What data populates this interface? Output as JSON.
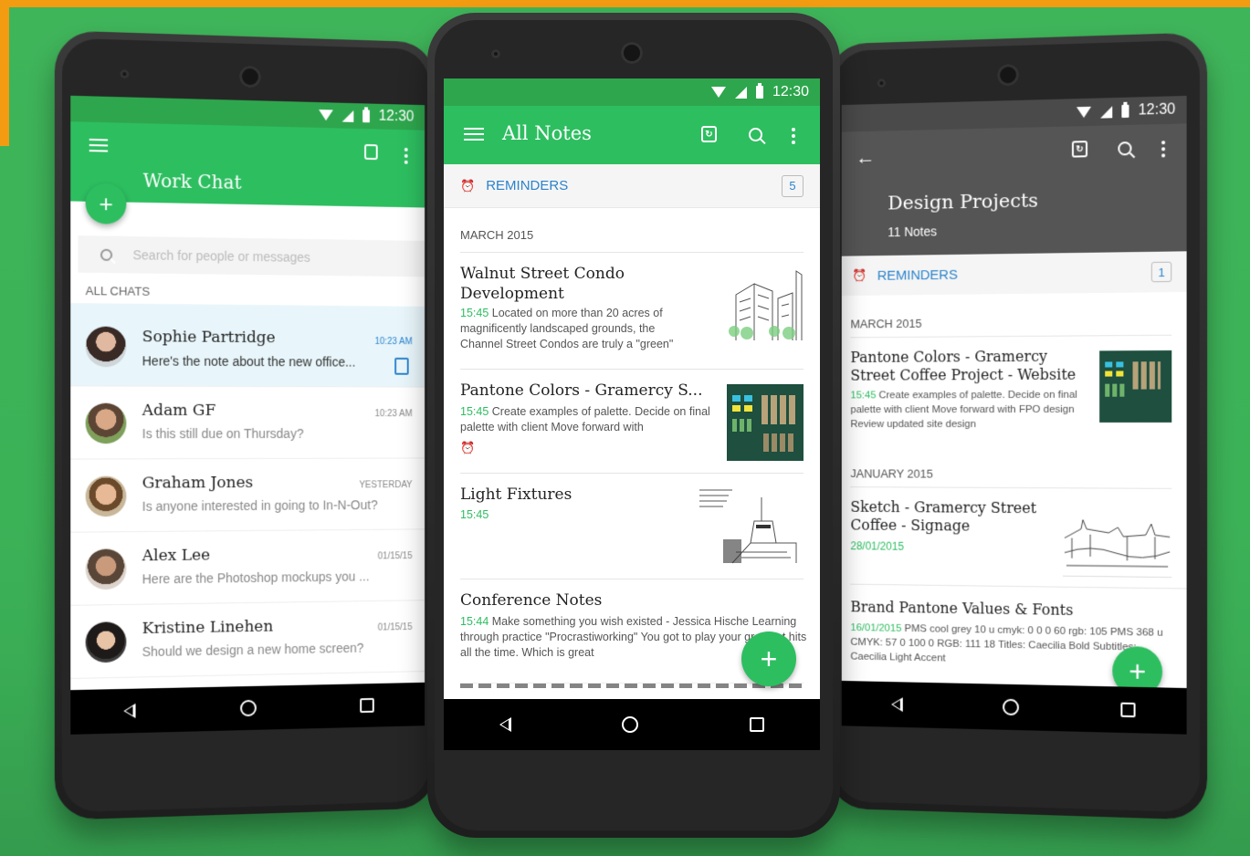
{
  "status": {
    "time": "12:30"
  },
  "work_chat": {
    "title": "Work Chat",
    "search_placeholder": "Search for people or messages",
    "section_label": "ALL CHATS",
    "fab_label": "+",
    "chats": [
      {
        "name": "Sophie Partridge",
        "message": "Here's the note about the new office...",
        "time": "10:23 AM"
      },
      {
        "name": "Adam GF",
        "message": "Is this still due on Thursday?",
        "time": "10:23 AM"
      },
      {
        "name": "Graham Jones",
        "message": "Is anyone interested in going to In-N-Out?",
        "time": "YESTERDAY"
      },
      {
        "name": "Alex Lee",
        "message": "Here are the Photoshop mockups you ...",
        "time": "01/15/15"
      },
      {
        "name": "Kristine Linehen",
        "message": "Should we design a new home screen?",
        "time": "01/15/15"
      }
    ]
  },
  "all_notes": {
    "title": "All Notes",
    "reminders_label": "REMINDERS",
    "reminders_count": "5",
    "month": "MARCH 2015",
    "fab_label": "+",
    "notes": [
      {
        "title": "Walnut Street Condo Development",
        "time": "15:45",
        "body": "Located on more than 20 acres of magnificently landscaped grounds, the Channel Street Condos are truly a \"green\""
      },
      {
        "title": "Pantone Colors - Gramercy S...",
        "time": "15:45",
        "body": "Create examples of palette.  Decide on final palette with client Move forward with"
      },
      {
        "title": "Light Fixtures",
        "time": "15:45",
        "body": ""
      },
      {
        "title": "Conference Notes",
        "time": "15:44",
        "body": "Make something you wish existed - Jessica Hische Learning through practice \"Procrastiworking\" You got to play  your greatest hits all the time.  Which is great"
      }
    ]
  },
  "design_projects": {
    "title": "Design Projects",
    "subtitle": "11 Notes",
    "reminders_label": "REMINDERS",
    "reminders_count": "1",
    "month_1": "MARCH 2015",
    "month_2": "JANUARY 2015",
    "fab_label": "+",
    "notes": [
      {
        "title": "Pantone Colors - Gramercy Street Coffee Project - Website",
        "time": "15:45",
        "body": "Create examples of palette.  Decide on final palette with client Move forward with FPO design Review updated site design"
      },
      {
        "title": "Sketch - Gramercy Street Coffee - Signage",
        "time": "28/01/2015",
        "body": ""
      },
      {
        "title": "Brand Pantone Values & Fonts",
        "time": "16/01/2015",
        "body": "PMS cool grey 10 u   cmyk: 0 0 0 60   rgb: 105   PMS 368 u   CMYK: 57 0 100 0   RGB: 111 18 Titles: Caecilia Bold   Subtitles: Caecilia Light   Accent"
      }
    ]
  },
  "colors": {
    "green": "#2dbe60",
    "green_bar": "#2ea64d",
    "dark_bar": "#555555",
    "link_blue": "#2a83cc"
  }
}
